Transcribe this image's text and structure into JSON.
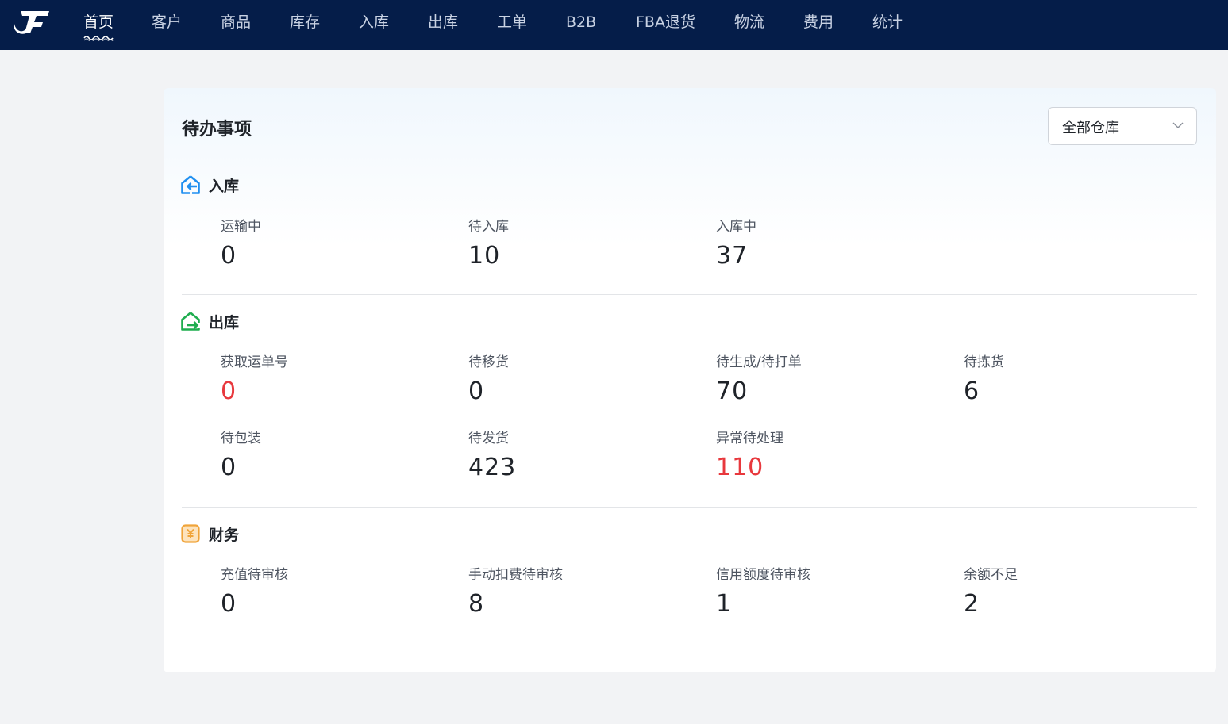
{
  "nav": {
    "items": [
      {
        "label": "首页",
        "active": true
      },
      {
        "label": "客户"
      },
      {
        "label": "商品"
      },
      {
        "label": "库存"
      },
      {
        "label": "入库"
      },
      {
        "label": "出库"
      },
      {
        "label": "工单"
      },
      {
        "label": "B2B"
      },
      {
        "label": "FBA退货"
      },
      {
        "label": "物流"
      },
      {
        "label": "费用"
      },
      {
        "label": "统计"
      }
    ]
  },
  "card": {
    "title": "待办事项",
    "warehouse_select": {
      "value": "全部仓库"
    }
  },
  "sections": {
    "inbound": {
      "title": "入库",
      "icon": "inbound-icon",
      "stats": [
        {
          "label": "运输中",
          "value": "0"
        },
        {
          "label": "待入库",
          "value": "10"
        },
        {
          "label": "入库中",
          "value": "37"
        }
      ]
    },
    "outbound": {
      "title": "出库",
      "icon": "outbound-icon",
      "stats": [
        {
          "label": "获取运单号",
          "value": "0",
          "alert": true
        },
        {
          "label": "待移货",
          "value": "0"
        },
        {
          "label": "待生成/待打单",
          "value": "70"
        },
        {
          "label": "待拣货",
          "value": "6"
        },
        {
          "label": "待包装",
          "value": "0"
        },
        {
          "label": "待发货",
          "value": "423"
        },
        {
          "label": "异常待处理",
          "value": "110",
          "alert": true
        }
      ]
    },
    "finance": {
      "title": "财务",
      "icon": "yen-icon",
      "stats": [
        {
          "label": "充值待审核",
          "value": "0"
        },
        {
          "label": "手动扣费待审核",
          "value": "8"
        },
        {
          "label": "信用额度待审核",
          "value": "1"
        },
        {
          "label": "余额不足",
          "value": "2"
        }
      ]
    }
  },
  "colors": {
    "nav_bg": "#051d49",
    "alert": "#e8383d",
    "inbound_icon": "#1f8ff0",
    "outbound_icon": "#1fad4f",
    "finance_icon": "#f0a43a"
  }
}
